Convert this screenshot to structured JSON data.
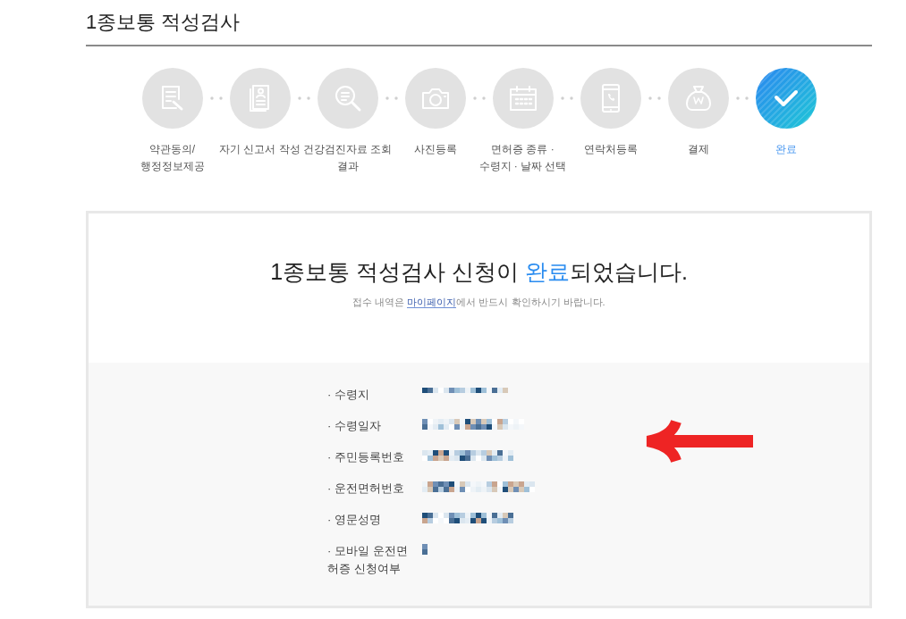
{
  "page_title": "1종보통 적성검사",
  "steps": [
    {
      "label": "약관동의/\n행정정보제공",
      "selected": false
    },
    {
      "label": "자기 신고서 작성",
      "selected": false
    },
    {
      "label": "건강검진자료 조회\n결과",
      "selected": false
    },
    {
      "label": "사진등록",
      "selected": false
    },
    {
      "label": "면허증 종류 ·\n수령지 · 날짜 선택",
      "selected": false
    },
    {
      "label": "연락처등록",
      "selected": false
    },
    {
      "label": "결제",
      "selected": false
    },
    {
      "label": "완료",
      "selected": true
    }
  ],
  "completion": {
    "heading": [
      {
        "text": "1종보통 적성검사 신청이 ",
        "highlight": false
      },
      {
        "text": "완료",
        "highlight": true
      },
      {
        "text": "되었습니다.",
        "highlight": false
      }
    ],
    "notice": {
      "before": "접수 내역은 ",
      "link": "마이페이지",
      "after": "에서 반드시 확인하시기 바랍니다."
    }
  },
  "details": [
    {
      "label": "· 수령지",
      "redacted": true
    },
    {
      "label": "· 수령일자",
      "redacted": true
    },
    {
      "label": "· 주민등록번호",
      "redacted": true
    },
    {
      "label": "· 운전면허번호",
      "redacted": true
    },
    {
      "label": "· 영문성명",
      "redacted": true
    },
    {
      "label": "· 모바일 운전면허증 신청여부",
      "redacted": true
    }
  ]
}
